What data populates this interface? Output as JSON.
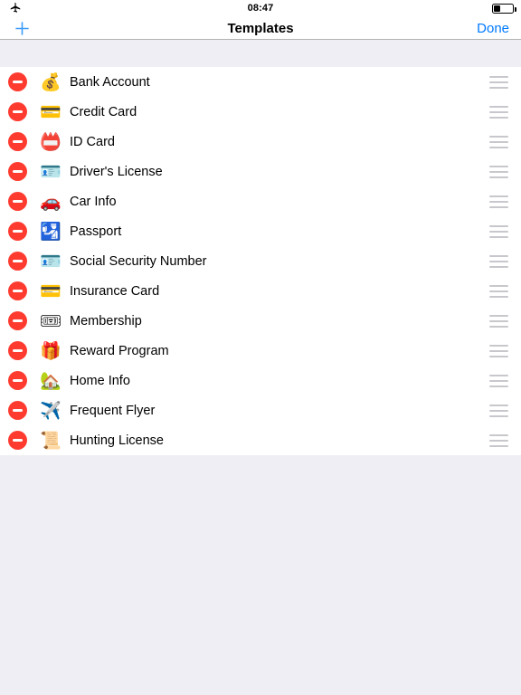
{
  "statusbar": {
    "airplane_icon": "airplane-mode-icon",
    "time": "08:47",
    "battery_icon": "battery-icon",
    "battery_percent": 32
  },
  "navbar": {
    "add_icon": "plus-icon",
    "add_label": "",
    "title": "Templates",
    "done_label": "Done",
    "accent_color": "#007AFF"
  },
  "list": {
    "delete_color": "#FF3B30",
    "background_color": "#EFEEF4",
    "row_background": "#FFFFFF",
    "items": [
      {
        "label": "Bank Account",
        "emoji": "💰",
        "icon_name": "money-bag-icon"
      },
      {
        "label": "Credit Card",
        "emoji": "💳",
        "icon_name": "credit-card-icon"
      },
      {
        "label": "ID Card",
        "emoji": "📛",
        "icon_name": "id-card-icon"
      },
      {
        "label": "Driver's License",
        "emoji": "🪪",
        "icon_name": "drivers-license-icon"
      },
      {
        "label": "Car Info",
        "emoji": "🚗",
        "icon_name": "car-icon"
      },
      {
        "label": "Passport",
        "emoji": "🛂",
        "icon_name": "passport-icon"
      },
      {
        "label": "Social Security Number",
        "emoji": "🪪",
        "icon_name": "social-security-card-icon"
      },
      {
        "label": "Insurance Card",
        "emoji": "💳",
        "icon_name": "insurance-card-icon"
      },
      {
        "label": "Membership",
        "emoji": "🎟",
        "icon_name": "membership-ticket-icon"
      },
      {
        "label": "Reward Program",
        "emoji": "🎁",
        "icon_name": "reward-gift-icon"
      },
      {
        "label": "Home Info",
        "emoji": "🏡",
        "icon_name": "house-icon"
      },
      {
        "label": "Frequent Flyer",
        "emoji": "✈️",
        "icon_name": "airplane-icon"
      },
      {
        "label": "Hunting License",
        "emoji": "📜",
        "icon_name": "hunting-license-scroll-icon"
      }
    ],
    "reorder_icon": "reorder-handle-icon",
    "delete_icon": "delete-minus-icon"
  }
}
